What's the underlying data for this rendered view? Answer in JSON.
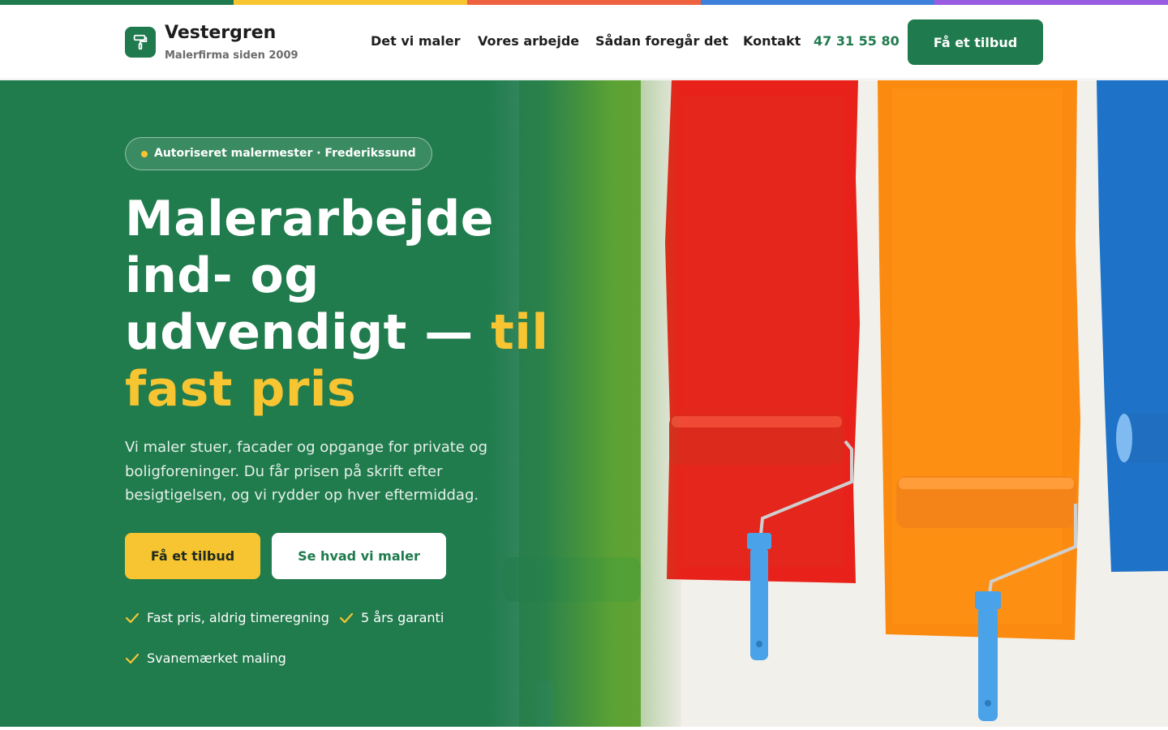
{
  "colors": {
    "brand_green": "#1f7a4d",
    "accent_yellow": "#f7c531",
    "stripe": [
      "#1f7a4d",
      "#f7c531",
      "#ee6240",
      "#3d7fd9",
      "#9a5be3"
    ]
  },
  "header": {
    "brand_name": "Vestergren",
    "brand_tagline": "Malerfirma siden 2009",
    "logo_icon": "paint-roller-icon",
    "nav": [
      "Det vi maler",
      "Vores arbejde",
      "Sådan foregår det",
      "Kontakt"
    ],
    "phone": "47 31 55 80",
    "cta_label": "Få et tilbud"
  },
  "hero": {
    "badge": "Autoriseret malermester · Frederikssund",
    "heading_line1": "Malerarbejde",
    "heading_line2": "ind- og",
    "heading_line3": "udvendigt —",
    "heading_accent1": "til",
    "heading_accent2": "fast pris",
    "lead": "Vi maler stuer, facader og opgange for private og boligforeninger. Du får prisen på skrift efter besigtigelsen, og vi rydder op hver eftermiddag.",
    "primary_cta": "Få et tilbud",
    "secondary_cta": "Se hvad vi maler",
    "features": [
      "Fast pris, aldrig timeregning",
      "5 års garanti",
      "Svanemærket maling"
    ],
    "image_description_icon": "paint-rollers-photo"
  }
}
